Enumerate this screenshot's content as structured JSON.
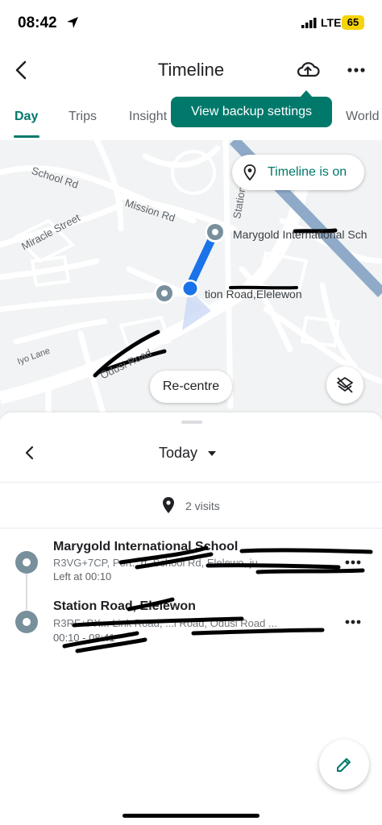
{
  "status_bar": {
    "time": "08:42",
    "network": "LTE",
    "battery": "65",
    "location_icon": "location-arrow-icon",
    "signal_icon": "signal-bars-icon"
  },
  "app_bar": {
    "title": "Timeline",
    "back_icon": "back-arrow-icon",
    "backup_icon": "cloud-upload-icon",
    "more_icon": "more-horizontal-icon"
  },
  "tabs": [
    {
      "label": "Day",
      "active": true
    },
    {
      "label": "Trips",
      "active": false
    },
    {
      "label": "Insight",
      "active": false
    },
    {
      "label": "World",
      "active": false
    }
  ],
  "tooltip": {
    "text": "View backup settings"
  },
  "map": {
    "timeline_chip": "Timeline is on",
    "recentre_label": "Re-centre",
    "street_labels": [
      "School Rd",
      "Mission Rd",
      "Miracle Street",
      "Station",
      "Iyo Lane",
      "Odusi Road"
    ],
    "place_labels": [
      "Marygold International Sch",
      "tion Road,Elelewon"
    ],
    "route_color": "#1a73e8",
    "major_road_color": "#8eaac8"
  },
  "sheet": {
    "date_label": "Today",
    "visits_count": "2 visits",
    "visits": [
      {
        "name": "Marygold International School",
        "address": "R3VG+7CP, Port...rt, School Rd, Elelewo, ju",
        "time": "Left at 00:10"
      },
      {
        "name": "Station Road, Elelewon",
        "address": "R3RF+PX... Link Road, ...l Road, Odusi Road ...",
        "time": "00:10 - 08:41"
      }
    ]
  },
  "colors": {
    "accent": "#00796b",
    "visit_dot": "#78909c"
  }
}
